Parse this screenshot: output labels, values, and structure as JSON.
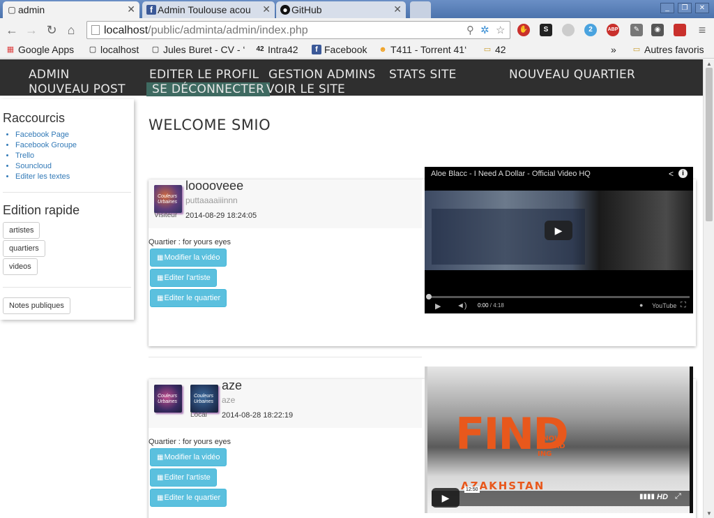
{
  "browser": {
    "tabs": [
      {
        "title": "admin",
        "icon": "page-icon",
        "active": true
      },
      {
        "title": "Admin Toulouse acou",
        "icon": "facebook-icon",
        "active": false
      },
      {
        "title": "GitHub",
        "icon": "github-icon",
        "active": false
      }
    ],
    "url_host": "localhost",
    "url_path": "/public/adminta/admin/index.php",
    "bookmarks": [
      {
        "label": "Google Apps",
        "icon": "apps-grid-icon"
      },
      {
        "label": "localhost",
        "icon": "page-icon"
      },
      {
        "label": "Jules Buret - CV - ‘",
        "icon": "page-icon"
      },
      {
        "label": "Intra42",
        "icon": "42-logo-icon"
      },
      {
        "label": "Facebook",
        "icon": "facebook-icon"
      },
      {
        "label": "T411 - Torrent 41‘",
        "icon": "t411-icon"
      },
      {
        "label": "42",
        "icon": "folder-icon"
      }
    ],
    "bookmarks_overflow": "»",
    "other_bookmarks": "Autres favoris",
    "extension_badge": "2",
    "abp_label": "ABP"
  },
  "nav": {
    "admin": "ADMIN",
    "editer_profil": "EDITER LE PROFIL",
    "gestion_admins": "GESTION ADMINS",
    "stats_site": "STATS SITE",
    "nouveau_quartier": "NOUVEAU QUARTIER",
    "nouveau_post": "NOUVEAU POST",
    "se_deconnecter": "SE DÉCONNECTER",
    "voir_le_site": "VOIR LE SITE"
  },
  "sidebar": {
    "raccourcis_title": "Raccourcis",
    "links": [
      "Facebook Page",
      "Facebook Groupe",
      "Trello",
      "Souncloud",
      "Editer les textes"
    ],
    "edition_title": "Edition rapide",
    "quick_buttons": [
      "artistes",
      "quartiers",
      "videos"
    ],
    "notes_button": "Notes publiques"
  },
  "main": {
    "welcome": "WELCOME SMIO",
    "posts": [
      {
        "name": "looooveee",
        "subtitle": "puttaaaaiiinnn",
        "role": "Visiteur",
        "date": "2014-08-29 18:24:05",
        "quartier": "Quartier : for yours eyes",
        "buttons": [
          "Modifier la vidéo",
          "Editer l'artiste",
          "Editer le quartier"
        ],
        "video": {
          "title": "Aloe Blacc - I Need A Dollar - Official Video HQ",
          "time_current": "0:00",
          "time_total": "4:18",
          "provider": "YouTube"
        }
      },
      {
        "name": "aze",
        "subtitle": "aze",
        "role": "Local",
        "date": "2014-08-28 18:22:19",
        "quartier": "Quartier : for yours eyes",
        "buttons": [
          "Modifier la vidéo",
          "Editer l'artiste",
          "Editer le quartier"
        ],
        "video": {
          "overlay_title": "FIND",
          "overlay_sub": "SNOW BOARD ING",
          "overlay_place": "AZAKHSTAN",
          "duration": "12:50",
          "quality": "HD"
        }
      }
    ],
    "thumb_text": "Couleurs Urbaines"
  }
}
